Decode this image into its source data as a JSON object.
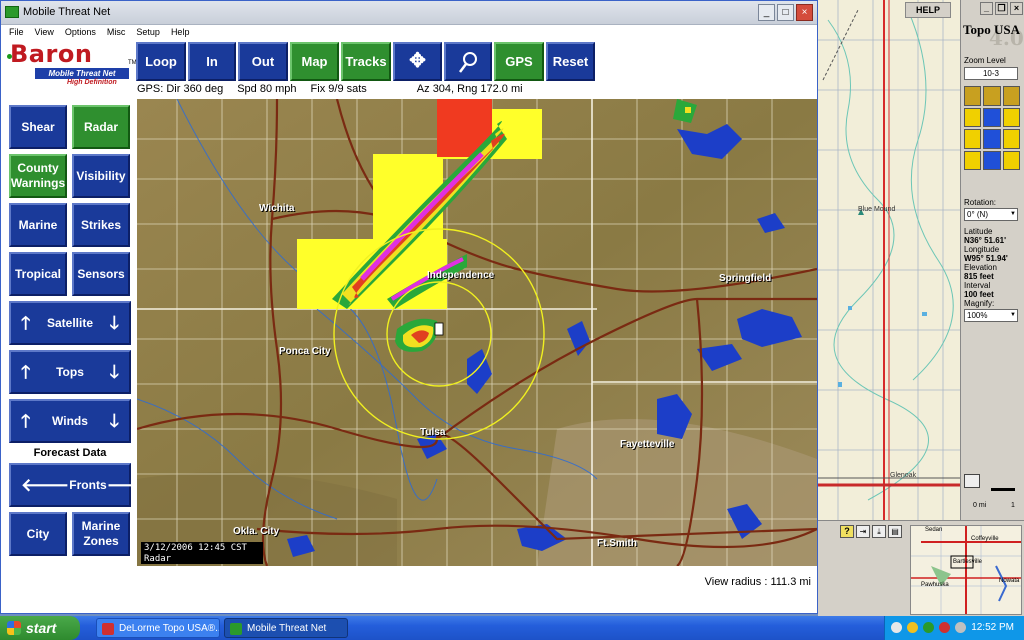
{
  "mtn_window": {
    "title": "Mobile Threat Net",
    "menu": [
      "File",
      "View",
      "Options",
      "Misc",
      "Setup",
      "Help"
    ],
    "caption_buttons": [
      "_",
      "□",
      "×"
    ]
  },
  "logo": {
    "name": "Baron",
    "subtitle": "Mobile Threat Net",
    "edition": "High Definition",
    "tm": "TM"
  },
  "toolbar": {
    "loop": "Loop",
    "in": "In",
    "out": "Out",
    "map": "Map",
    "tracks": "Tracks",
    "gps": "GPS",
    "reset": "Reset"
  },
  "gps_status": {
    "direction": "GPS: Dir 360 deg",
    "speed": "Spd 80 mph",
    "fix": "Fix 9/9 sats",
    "azimuth_range": "Az 304, Rng 172.0 mi"
  },
  "sidebar": {
    "shear": "Shear",
    "radar": "Radar",
    "county_warnings": "County Warnings",
    "visibility": "Visibility",
    "marine": "Marine",
    "strikes": "Strikes",
    "tropical": "Tropical",
    "sensors": "Sensors",
    "satellite": "Satellite",
    "tops": "Tops",
    "winds": "Winds",
    "forecast_header": "Forecast Data",
    "fronts": "Fronts",
    "city": "City",
    "marine_zones": "Marine Zones"
  },
  "map": {
    "cities": [
      "Wichita",
      "Independence",
      "Springfield",
      "Ponca City",
      "Tulsa",
      "Fayetteville",
      "Okla. City",
      "Ft.Smith"
    ],
    "timestamp": "3/12/2006 12:45 CST",
    "product": "Radar",
    "view_radius": "View radius : 111.3 mi"
  },
  "topo": {
    "help": "HELP",
    "title": "Topo USA",
    "version": "4.0",
    "zoom_label": "Zoom Level",
    "zoom_value": "10-3",
    "rotation_label": "Rotation:",
    "rotation_value": "0° (N)",
    "latitude_label": "Latitude",
    "latitude_value": "N36° 51.61'",
    "longitude_label": "Longitude",
    "longitude_value": "W95° 51.94'",
    "elevation_label": "Elevation",
    "elevation_value": "815 feet",
    "interval_label": "Interval",
    "interval_value": "100 feet",
    "magnify_label": "Magnify:",
    "magnify_value": "100%",
    "scale_label": "0 mi",
    "scale_end": "1",
    "map_labels": [
      "Blue Mound",
      "Glenoak"
    ],
    "overview_labels": [
      "Sedan",
      "Coffeyville",
      "Bartlesville",
      "Pawhuska",
      "Nowata"
    ]
  },
  "taskbar": {
    "start": "start",
    "tasks": [
      "DeLorme Topo USA®...",
      "Mobile Threat Net"
    ],
    "clock": "12:52 PM"
  },
  "colors": {
    "button_blue": "#1a3a9a",
    "button_green": "#2f8f2f",
    "brand_red": "#c01a20",
    "warning_yellow": "#ffff2a",
    "warning_red": "#f03a20"
  }
}
